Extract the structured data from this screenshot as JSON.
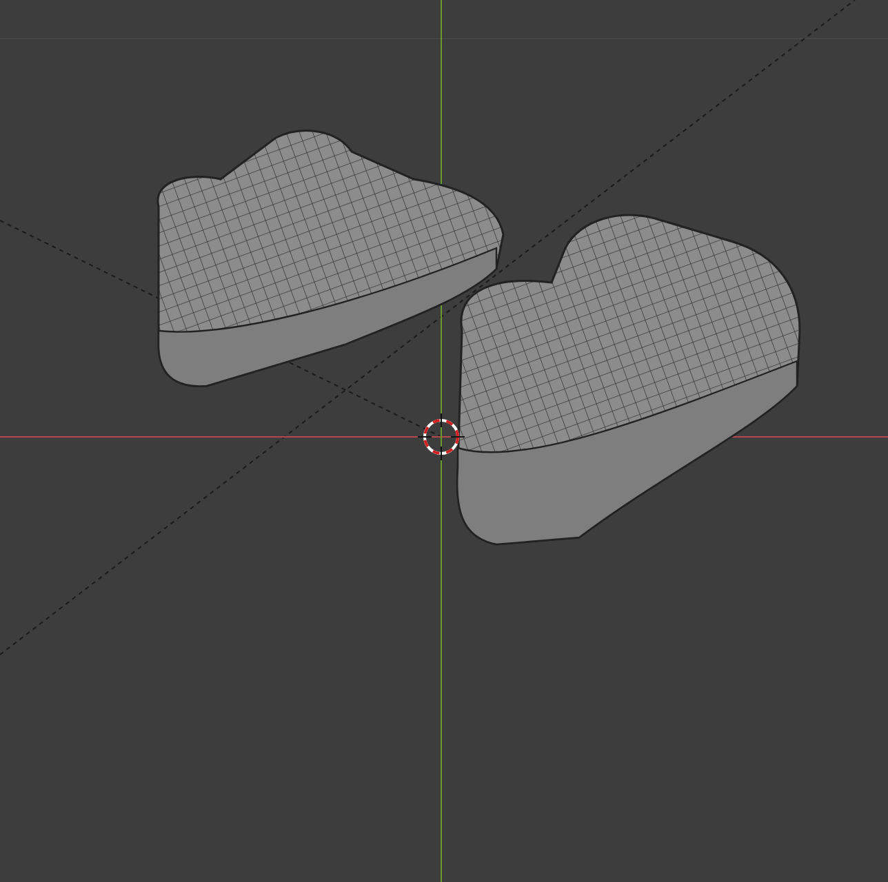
{
  "viewport": {
    "objects": [
      {
        "kind": "shoe"
      },
      {
        "kind": "shoe"
      }
    ]
  }
}
